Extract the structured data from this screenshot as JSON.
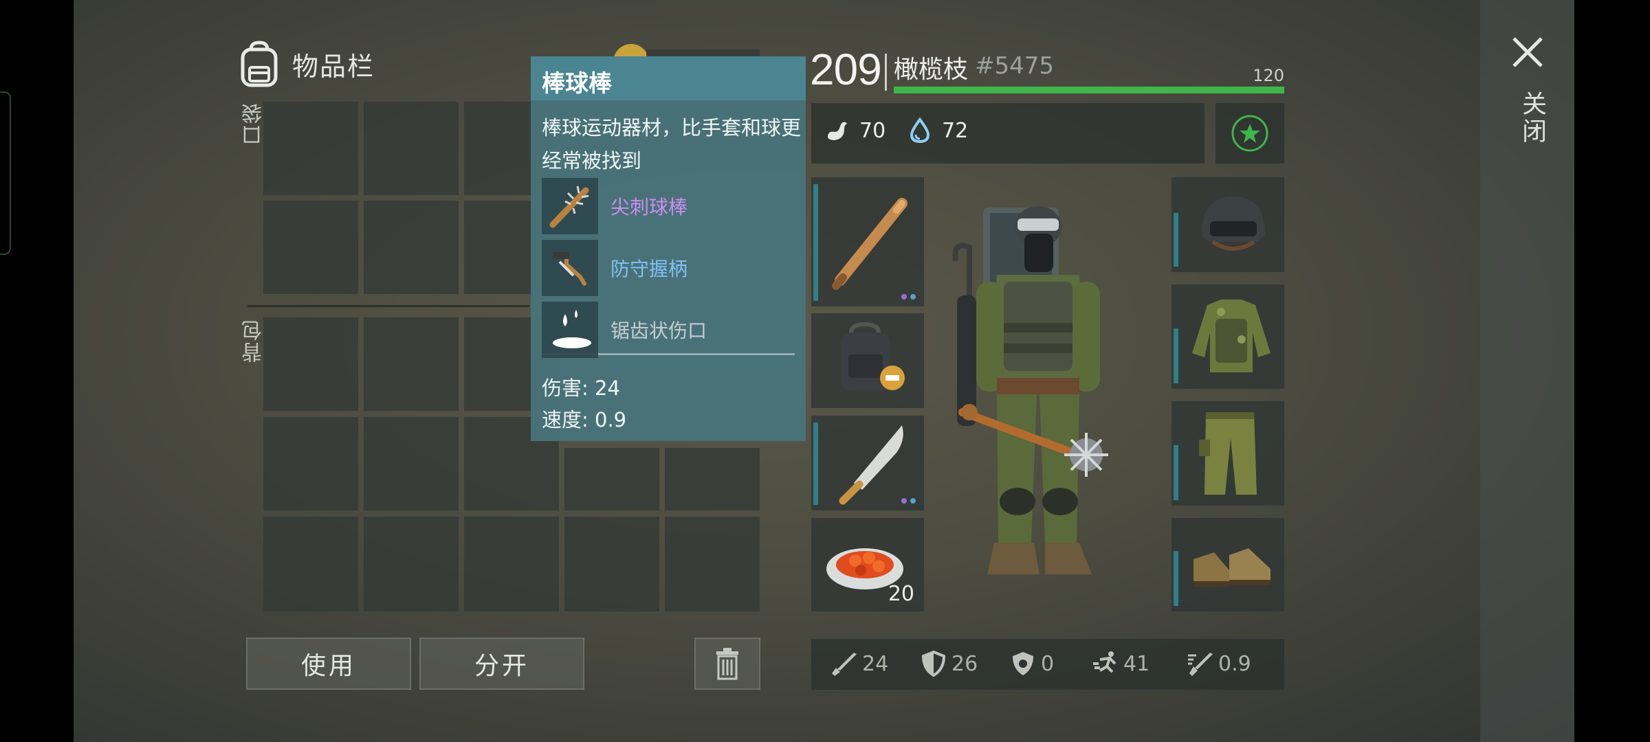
{
  "inventory": {
    "title": "物品栏",
    "pocket_label": "口袋",
    "backpack_label": "背包",
    "use_button": "使用",
    "split_button": "分开"
  },
  "tooltip": {
    "title": "棒球棒",
    "description": "棒球运动器材，比手套和球更经常被找到",
    "mods": [
      {
        "label": "尖刺球棒",
        "color": "#c98ff0",
        "icon": "spiked-bat-icon"
      },
      {
        "label": "防守握柄",
        "color": "#7fc0f4",
        "icon": "grip-icon"
      }
    ],
    "effect": {
      "label": "锯齿状伤口",
      "color": "#c3ced0",
      "icon": "bleeding-icon"
    },
    "damage": "伤害: 24",
    "speed": "速度: 0.9"
  },
  "character": {
    "level": "209",
    "name": "橄榄枝",
    "id": "#5475",
    "hp_value": "120",
    "hp_fraction": 1.0,
    "hunger": "70",
    "thirst": "72",
    "food_quantity": "20"
  },
  "stats": {
    "attack": "24",
    "defense": "26",
    "toxic_defense": "0",
    "move_speed": "41",
    "attack_speed": "0.9"
  },
  "close_label": "关闭",
  "colors": {
    "hp_bar": "#3fb54a",
    "tooltip_bg": "#4a8591",
    "durability_bar": "#2f7f86",
    "star_green": "#3fb54a"
  }
}
